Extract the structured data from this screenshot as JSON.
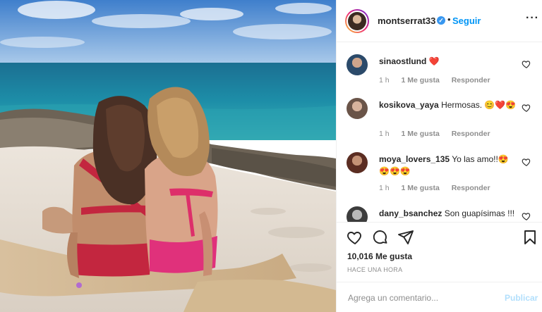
{
  "post": {
    "author": {
      "username": "montserrat33",
      "verified": true,
      "follow_label": "Seguir",
      "separator": "•"
    },
    "comments": [
      {
        "username": "sinaostlund",
        "text": "❤️",
        "meta": {
          "age": "1 h",
          "likes": "1 Me gusta",
          "reply": "Responder"
        }
      },
      {
        "username": "kosikova_yaya",
        "text": "Hermosas. 😊❤️😍",
        "meta": {
          "age": "1 h",
          "likes": "1 Me gusta",
          "reply": "Responder"
        }
      },
      {
        "username": "moya_lovers_135",
        "text": "Yo las amo!!😍😍😍😍",
        "meta": {
          "age": "1 h",
          "likes": "1 Me gusta",
          "reply": "Responder"
        }
      },
      {
        "username": "dany_bsanchez",
        "text": "Son guapísimas !!!"
      }
    ],
    "likes_label": "10,016 Me gusta",
    "time_label": "HACE UNA HORA",
    "add_comment": {
      "placeholder": "Agrega un comentario...",
      "publish_label": "Publicar"
    }
  },
  "icons": {
    "more": "more-options-icon",
    "like": "heart-icon",
    "comment": "comment-bubble-icon",
    "share": "paper-plane-icon",
    "save": "bookmark-icon",
    "verified": "verified-badge-icon"
  },
  "colors": {
    "link_blue": "#0095f6",
    "verified_blue": "#3897f0",
    "publish_disabled": "#b2dffc",
    "muted_text": "#8e8e8e",
    "heart_red": "#ed4956"
  }
}
